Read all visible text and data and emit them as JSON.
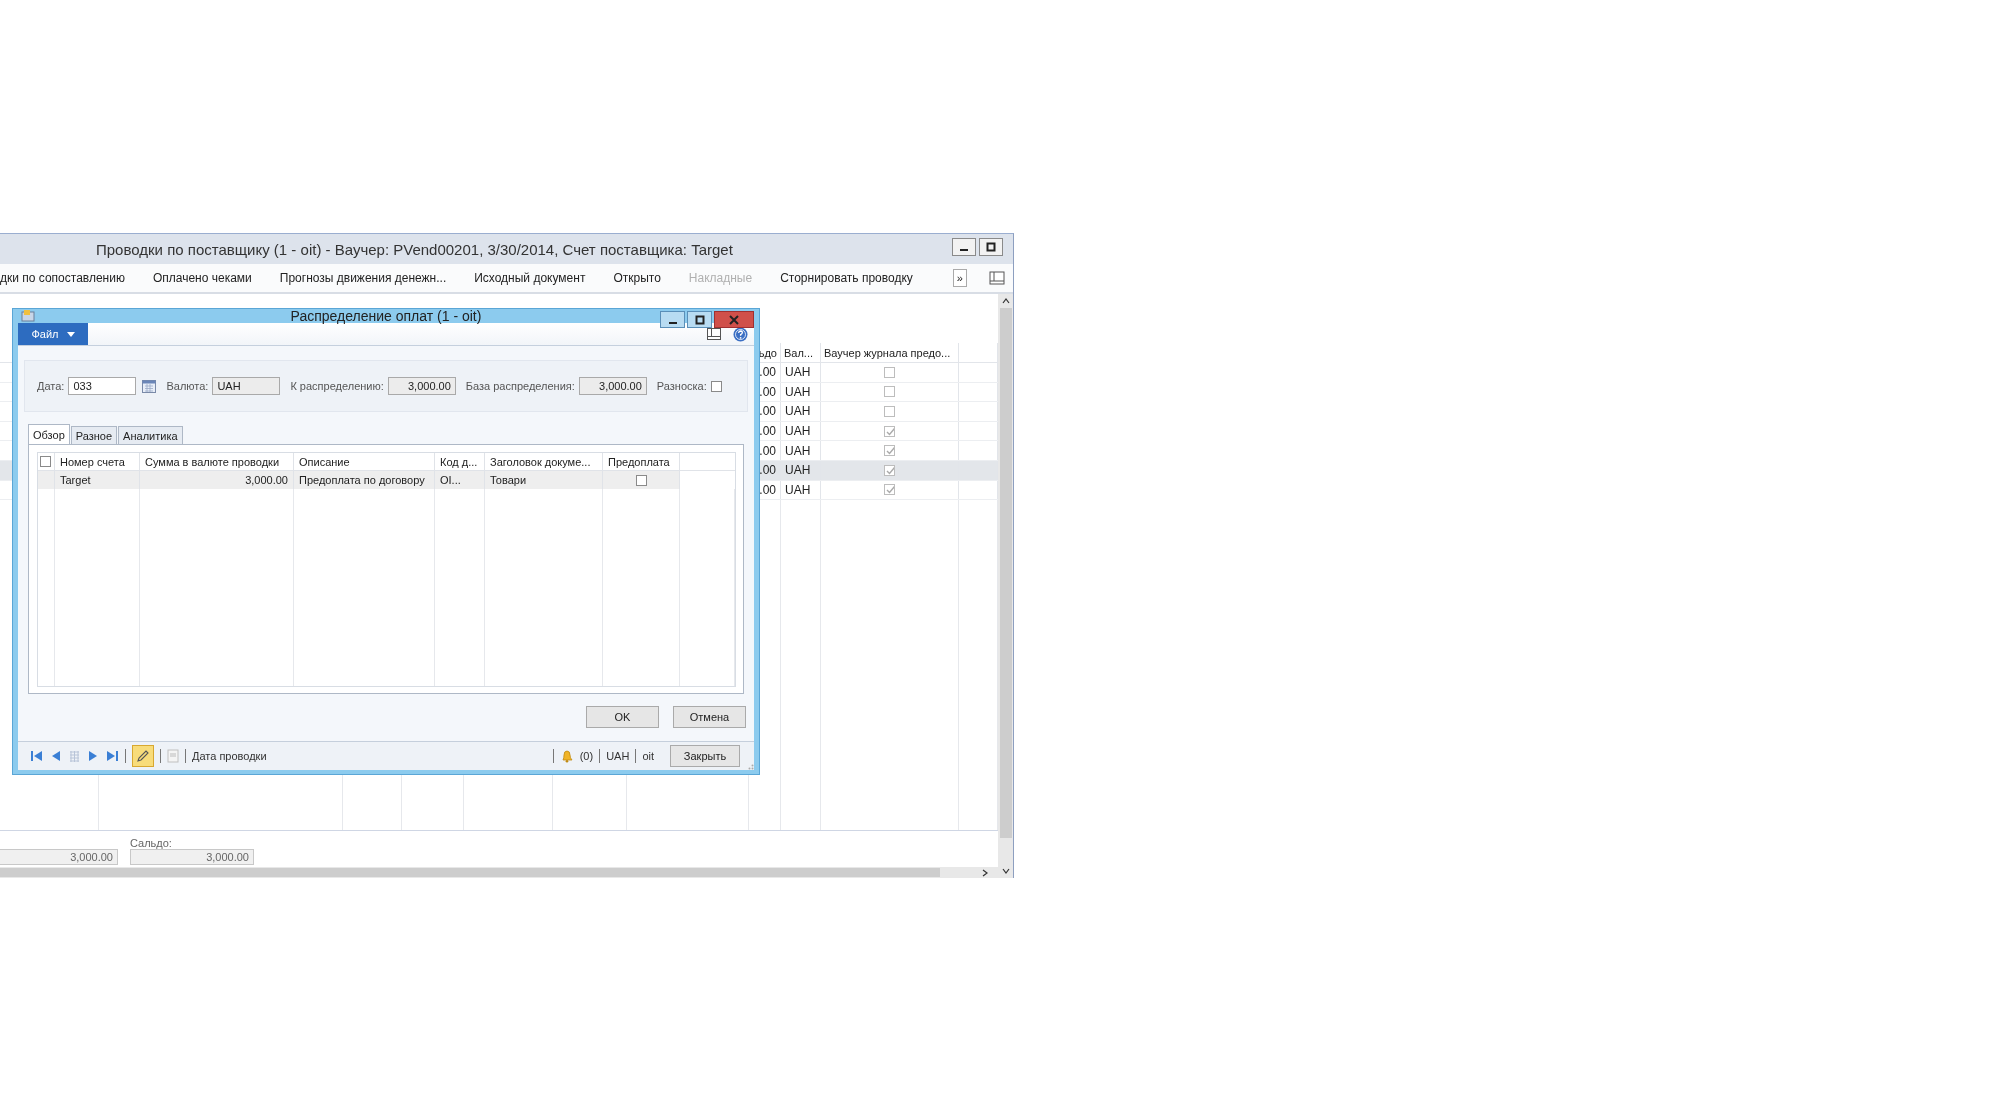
{
  "main_window": {
    "title": "Проводки по поставщику (1 - oit) - Ваучер: PVend00201, 3/30/2014, Счет поставщика: Target",
    "toolbar": [
      {
        "label": "дки по сопоставлению",
        "disabled": false
      },
      {
        "label": "Оплачено чеками",
        "disabled": false
      },
      {
        "label": "Прогнозы движения денежн...",
        "disabled": false
      },
      {
        "label": "Исходный документ",
        "disabled": false
      },
      {
        "label": "Открыто",
        "disabled": false
      },
      {
        "label": "Накладные",
        "disabled": true
      },
      {
        "label": "Сторнировать проводку",
        "disabled": false
      }
    ],
    "overflow": "»",
    "grid": {
      "columns": [
        "ьдо",
        "Вал...",
        "Ваучер журнала предо..."
      ],
      "rows": [
        {
          "balance": ".00",
          "currency": "UAH",
          "voucher": false,
          "selected": false
        },
        {
          "balance": ".00",
          "currency": "UAH",
          "voucher": false,
          "selected": false
        },
        {
          "balance": ".00",
          "currency": "UAH",
          "voucher": false,
          "selected": false
        },
        {
          "balance": ".00",
          "currency": "UAH",
          "voucher": true,
          "selected": false
        },
        {
          "balance": ".00",
          "currency": "UAH",
          "voucher": true,
          "selected": false
        },
        {
          "balance": ".00",
          "currency": "UAH",
          "voucher": true,
          "selected": true
        },
        {
          "balance": ".00",
          "currency": "UAH",
          "voucher": true,
          "selected": false
        }
      ]
    },
    "footer": {
      "total": "3,000.00",
      "balance_label": "Сальдо:",
      "balance": "3,000.00"
    }
  },
  "dialog": {
    "title": "Распределение оплат (1 - oit)",
    "file_menu": "Файл",
    "fields": {
      "date_label": "Дата:",
      "date": "033",
      "currency_label": "Валюта:",
      "currency": "UAH",
      "to_distribute_label": "К распределению:",
      "to_distribute": "3,000.00",
      "base_label": "База распределения:",
      "base": "3,000.00",
      "posting_label": "Разноска:",
      "posting": false
    },
    "tabs": [
      {
        "label": "Обзор",
        "selected": true
      },
      {
        "label": "Разное",
        "selected": false
      },
      {
        "label": "Аналитика",
        "selected": false
      }
    ],
    "table": {
      "select_all": false,
      "columns": [
        "Номер счета",
        "Сумма в валюте проводки",
        "Описание",
        "Код д...",
        "Заголовок докуме...",
        "Предоплата"
      ],
      "rows": [
        {
          "account": "Target",
          "amount": "3,000.00",
          "description": "Предоплата по договору",
          "code": "OI...",
          "doc_header": "Товари",
          "prepayment": false,
          "selected": true
        }
      ]
    },
    "buttons": [
      "OK",
      "Отмена"
    ],
    "status_bar": {
      "edit_mode": true,
      "record_label": "Дата проводки",
      "notifications": "(0)",
      "currency": "UAH",
      "company": "oit",
      "close": "Закрыть"
    }
  }
}
